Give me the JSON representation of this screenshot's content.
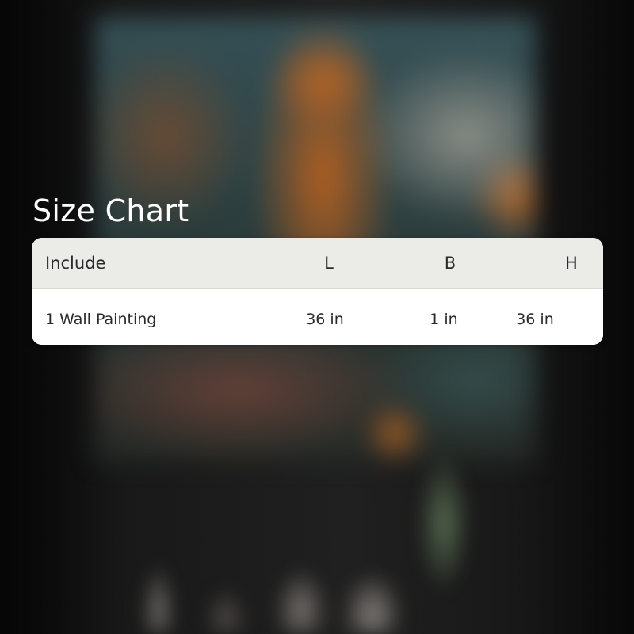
{
  "title": "Size Chart",
  "table": {
    "headers": [
      "Include",
      "L",
      "B",
      "H"
    ],
    "rows": [
      [
        "1 Wall Painting",
        "36 in",
        "1 in",
        "36 in"
      ]
    ]
  }
}
